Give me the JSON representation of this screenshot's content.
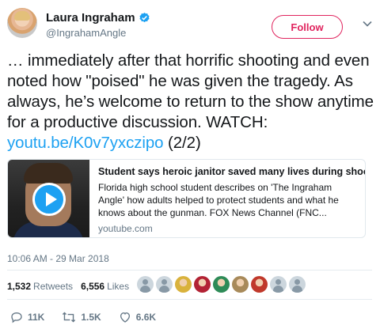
{
  "author": {
    "name": "Laura Ingraham",
    "handle": "@IngrahamAngle",
    "follow_label": "Follow"
  },
  "tweet": {
    "text_before_link": "… immediately after that horrific shooting and even noted how \"poised\" he was given the tragedy. As always, he’s welcome to return to the show anytime for a productive discussion. WATCH: ",
    "link_text": "youtu.be/K0v7yxczipo",
    "text_after_link": " (2/2)"
  },
  "card": {
    "title": "Student says heroic janitor saved many lives during shooting",
    "description": "Florida high school student describes on 'The Ingraham Angle' how adults helped to protect students and what he knows about the gunman. FOX News Channel (FNC...",
    "domain": "youtube.com"
  },
  "timestamp": "10:06 AM - 29 Mar 2018",
  "stats": {
    "retweets_count": "1,532",
    "retweets_label": "Retweets",
    "likes_count": "6,556",
    "likes_label": "Likes"
  },
  "likers": [
    {
      "icon": "default-avatar",
      "color": "#ccd6dd"
    },
    {
      "icon": "default-avatar",
      "color": "#ccd6dd"
    },
    {
      "icon": "user-avatar",
      "color": "#d9b23c"
    },
    {
      "icon": "flag-avatar",
      "color": "#b22234"
    },
    {
      "icon": "user-avatar",
      "color": "#2e8b57"
    },
    {
      "icon": "user-avatar",
      "color": "#a88a5a"
    },
    {
      "icon": "user-avatar",
      "color": "#c0392b"
    },
    {
      "icon": "default-avatar",
      "color": "#ccd6dd"
    },
    {
      "icon": "default-avatar",
      "color": "#ccd6dd"
    }
  ],
  "actions": {
    "reply_count": "11K",
    "retweet_count": "1.5K",
    "like_count": "6.6K"
  },
  "colors": {
    "link": "#1da1f2",
    "follow": "#e0245e",
    "muted": "#657786"
  }
}
